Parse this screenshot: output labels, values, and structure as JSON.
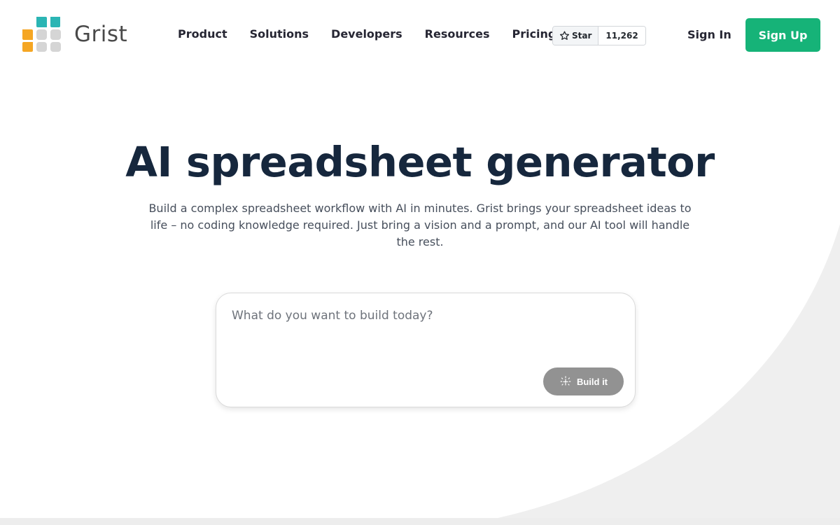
{
  "header": {
    "logo_text": "Grist",
    "nav": [
      "Product",
      "Solutions",
      "Developers",
      "Resources",
      "Pricing"
    ],
    "github": {
      "star_label": "Star",
      "star_count": "11,262",
      "icon": "star-outline-icon"
    },
    "sign_in": "Sign In",
    "sign_up": "Sign Up"
  },
  "hero": {
    "title": "AI spreadsheet generator",
    "subtitle": "Build a complex spreadsheet workflow with AI in minutes. Grist brings your spreadsheet ideas to life – no coding knowledge required. Just bring a vision and a prompt, and our AI tool will handle the rest."
  },
  "prompt": {
    "placeholder": "What do you want to build today?",
    "build_label": "Build it",
    "build_icon": "sparkle-icon"
  },
  "colors": {
    "brand_green": "#16b378",
    "logo_teal": "#2bb5b4",
    "logo_orange": "#f5a623",
    "logo_gray": "#d5d5d5",
    "title_navy": "#16273d",
    "build_button_disabled": "#929292",
    "background_curve": "#efefef"
  }
}
